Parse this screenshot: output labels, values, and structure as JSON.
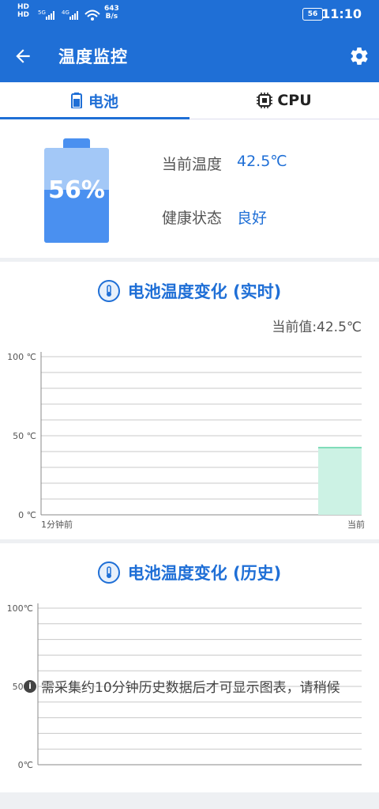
{
  "status_bar": {
    "hd1": "HD",
    "hd2": "HD",
    "net_speed": "643",
    "net_unit": "B/s",
    "battery": "56",
    "time": "11:10",
    "sig1": "5G",
    "sig2": "4G"
  },
  "app_bar": {
    "title": "温度监控",
    "back_icon": "arrow-left-icon",
    "settings_icon": "gear-icon"
  },
  "tabs": [
    {
      "label": "电池",
      "icon": "battery-icon",
      "active": true
    },
    {
      "label": "CPU",
      "icon": "cpu-chip-icon",
      "active": false
    }
  ],
  "battery_info": {
    "level_percent": 56,
    "level_text": "56%",
    "temp_label": "当前温度",
    "temp_value": "42.5℃",
    "health_label": "健康状态",
    "health_value": "良好"
  },
  "realtime": {
    "title": "电池温度变化 (实时)",
    "current_value_text": "当前值:42.5℃"
  },
  "history": {
    "title": "电池温度变化 (历史)",
    "message": "需采集约10分钟历史数据后才可显示图表，请稍候"
  },
  "chart_data": [
    {
      "type": "area",
      "title": "电池温度变化 (实时)",
      "y_ticks": [
        "100 ℃",
        "50 ℃",
        "0 ℃"
      ],
      "x_ticks": [
        "1分钟前",
        "当前"
      ],
      "ylim": [
        0,
        100
      ],
      "series": [
        {
          "values": [
            42.5
          ]
        }
      ],
      "grid": true,
      "color": "#ccf2e4"
    },
    {
      "type": "line",
      "title": "电池温度变化 (历史)",
      "y_ticks": [
        "100℃",
        "50℃",
        "0℃"
      ],
      "ylim": [
        0,
        100
      ],
      "series": [],
      "grid": true
    }
  ]
}
